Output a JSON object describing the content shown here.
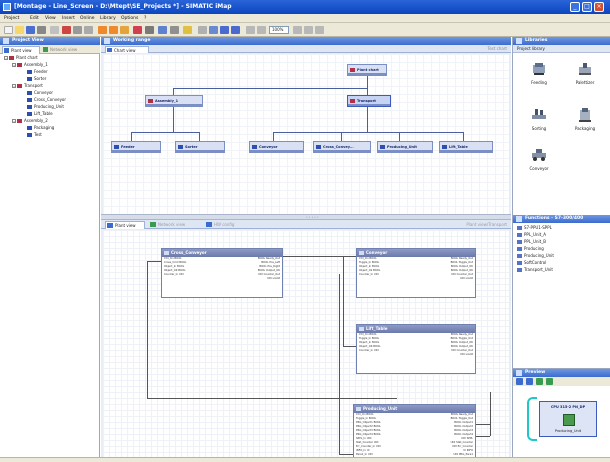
{
  "window": {
    "title": "[Montage - Line_Screen - D:\\Mtept\\SE_Projects *] - SIMATIC iMap",
    "controls": [
      "minimize",
      "maximize",
      "close"
    ]
  },
  "menu": [
    "Project",
    "Edit",
    "View",
    "Insert",
    "Online",
    "Library",
    "Options",
    "?"
  ],
  "toolbar": {
    "zoom_value": "100%"
  },
  "left_panel": {
    "title": "Project View",
    "tabs": [
      {
        "label": "Plant view"
      },
      {
        "label": "Network view"
      }
    ],
    "tree": [
      {
        "label": "Plant chart",
        "level": 0,
        "expanded": true,
        "color": "#b03048"
      },
      {
        "label": "Assembly_1",
        "level": 1,
        "expanded": true,
        "color": "#b03048"
      },
      {
        "label": "Feeder",
        "level": 2,
        "color": "#2d4fb0"
      },
      {
        "label": "Sorter",
        "level": 2,
        "color": "#2d4fb0"
      },
      {
        "label": "Transport",
        "level": 1,
        "expanded": true,
        "color": "#b03048"
      },
      {
        "label": "Conveyor",
        "level": 2,
        "color": "#2d4fb0"
      },
      {
        "label": "Cross_Conveyor",
        "level": 2,
        "color": "#2d4fb0"
      },
      {
        "label": "Producing_Unit",
        "level": 2,
        "color": "#2d4fb0"
      },
      {
        "label": "Lift_Table",
        "level": 2,
        "color": "#2d4fb0"
      },
      {
        "label": "Assembly_2",
        "level": 1,
        "expanded": true,
        "color": "#b03048"
      },
      {
        "label": "Packaging",
        "level": 2,
        "color": "#2d4fb0"
      },
      {
        "label": "Test",
        "level": 2,
        "color": "#2d4fb0"
      }
    ]
  },
  "main": {
    "title": "Working range",
    "chart_tab": "Chart view",
    "chart_hint": "Test chart",
    "chart_nodes": {
      "plant": "Plant chart",
      "assembly": "Assembly_1",
      "transport": "Transport",
      "feeder": "Feeder",
      "sorter": "Sorter",
      "conveyor": "Conveyor",
      "cross": "Cross_Convey...",
      "producing": "Producing_Unit",
      "lift": "Lift_Table"
    },
    "lower_tabs": [
      {
        "label": "Plant view"
      },
      {
        "label": "Network view"
      },
      {
        "label": "HW config"
      }
    ],
    "lower_hint": "Plant view/Transport",
    "function_blocks": {
      "cross": {
        "title": "Cross_Conveyor",
        "rows": [
          {
            "in": "Ctrl_On   BOOL",
            "out": "BOOL  Ready_Out"
          },
          {
            "in": "Cross_Cmd BOOL",
            "out": "BOOL  Pos_Left"
          },
          {
            "in": "Object_In BOOL",
            "out": "BOOL  Pos_Right"
          },
          {
            "in": "Object_OK BOOL",
            "out": "BOOL  Output_OK"
          },
          {
            "in": "Counter_In  UDI",
            "out": "UDI  Counter_Out"
          },
          {
            "in": "",
            "out": "UDI  uiAdd"
          }
        ]
      },
      "conveyor": {
        "title": "Conveyor",
        "rows": [
          {
            "in": "Ctrl_On   BOOL",
            "out": "BOOL  Ready_Out"
          },
          {
            "in": "Toggle_In BOOL",
            "out": "BOOL  Toggle_Out"
          },
          {
            "in": "Object_In BOOL",
            "out": "BOOL  Output_OK"
          },
          {
            "in": "Object_Ok BOOL",
            "out": "BOOL  Output_OK"
          },
          {
            "in": "Counter_In  UDI",
            "out": "UDI  Counter_Out"
          },
          {
            "in": "",
            "out": "UDI  uiAdd"
          }
        ]
      },
      "lift": {
        "title": "Lift_Table",
        "rows": [
          {
            "in": "Ctrl_On   BOOL",
            "out": "BOOL  Ready_Out"
          },
          {
            "in": "Toggle_In BOOL",
            "out": "BOOL  Toggle_Out"
          },
          {
            "in": "Object_In BOOL",
            "out": "BOOL  Output_OK"
          },
          {
            "in": "Object_OK BOOL",
            "out": "BOOL  Output_OK"
          },
          {
            "in": "Counter_In  UDI",
            "out": "UDI  Counter_Out"
          },
          {
            "in": "",
            "out": "UDI  uiAdd"
          }
        ]
      },
      "producing": {
        "title": "Producing_Unit",
        "rows": [
          {
            "in": "Ctrl_On    BOOL",
            "out": "BOOL  Ready_Out"
          },
          {
            "in": "Toggle_In  BOOL",
            "out": "BOOL  Toggle_Out"
          },
          {
            "in": "PRG_Object1 BOOL",
            "out": "BOOL  Output1"
          },
          {
            "in": "PRG_Object2 BOOL",
            "out": "BOOL  Output2"
          },
          {
            "in": "PRG_Object3 BOOL",
            "out": "BOOL  Output3"
          },
          {
            "in": "PRG_Object4 BOOL",
            "out": "BOOL  Output4"
          },
          {
            "in": "SPPL_In    UDI",
            "out": "UDI  SPPL"
          },
          {
            "in": "Stat_Counter UDI",
            "out": "UDI  Stat_Counter"
          },
          {
            "in": "Err_Counter_In UDI",
            "out": "UDI  Err_Counter"
          },
          {
            "in": "INFO_In    UI",
            "out": "UI  INFO"
          },
          {
            "in": "Para1_In   UDI",
            "out": "UDI  PRG_Para1"
          },
          {
            "in": "Para2_In   UDI",
            "out": "UDI  PRG_Para2"
          }
        ]
      }
    }
  },
  "right_panel": {
    "library_title": "Libraries",
    "library_sub": "Project library",
    "library_items": [
      {
        "label": "Feeding",
        "icon": "feeding-icon"
      },
      {
        "label": "Palettizer",
        "icon": "palettizer-icon"
      },
      {
        "label": "Sorting",
        "icon": "sorting-icon"
      },
      {
        "label": "Packaging",
        "icon": "packaging-icon"
      },
      {
        "label": "Conveyor",
        "icon": "conveyor-icon"
      }
    ],
    "functions_title": "Functions - S7-300/400",
    "functions": [
      "S7-PPU1-SPPL",
      "PPL_Unit_A",
      "PPL_Unit_B",
      "Producing",
      "Producing_Unit",
      "SoftControl",
      "Transport_Unit"
    ],
    "preview_title": "Preview",
    "preview": {
      "device": "CPU 315-2 PN_DP",
      "label": "Producing_Unit"
    }
  }
}
